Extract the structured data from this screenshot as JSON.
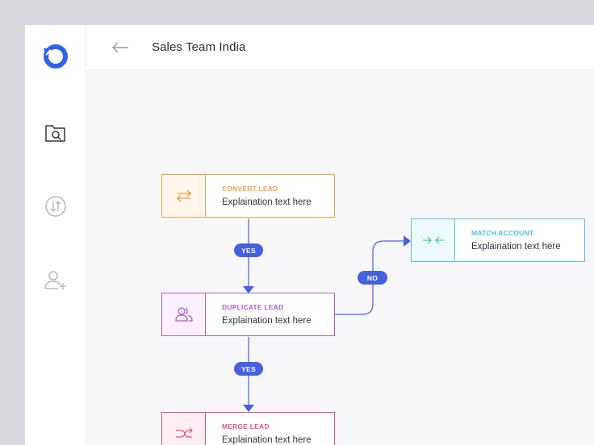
{
  "header": {
    "title": "Sales Team India"
  },
  "nodes": {
    "convert": {
      "label": "CONVERT LEAD",
      "desc": "Explaination text here",
      "color": "#f0a44a",
      "bg": "#fef6ec"
    },
    "duplicate": {
      "label": "DUPLICATE LEAD",
      "desc": "Explaination text here",
      "color": "#b35bd0",
      "bg": "#faf0fd"
    },
    "merge": {
      "label": "MERGE LEAD",
      "desc": "Explaination text here",
      "color": "#e0567f",
      "bg": "#fdeef3"
    },
    "match": {
      "label": "MATCH ACCOUNT",
      "desc": "Explaination text here",
      "color": "#4cc3e0",
      "bg": "#edf9fd"
    }
  },
  "connectors": {
    "yes1": "YES",
    "yes2": "YES",
    "no": "NO",
    "color": "#4561e0"
  },
  "sidebar": {
    "icons": [
      "logo-icon",
      "folder-search-icon",
      "sync-arrows-icon",
      "add-user-icon"
    ],
    "logo_color": "#2d63e8"
  }
}
